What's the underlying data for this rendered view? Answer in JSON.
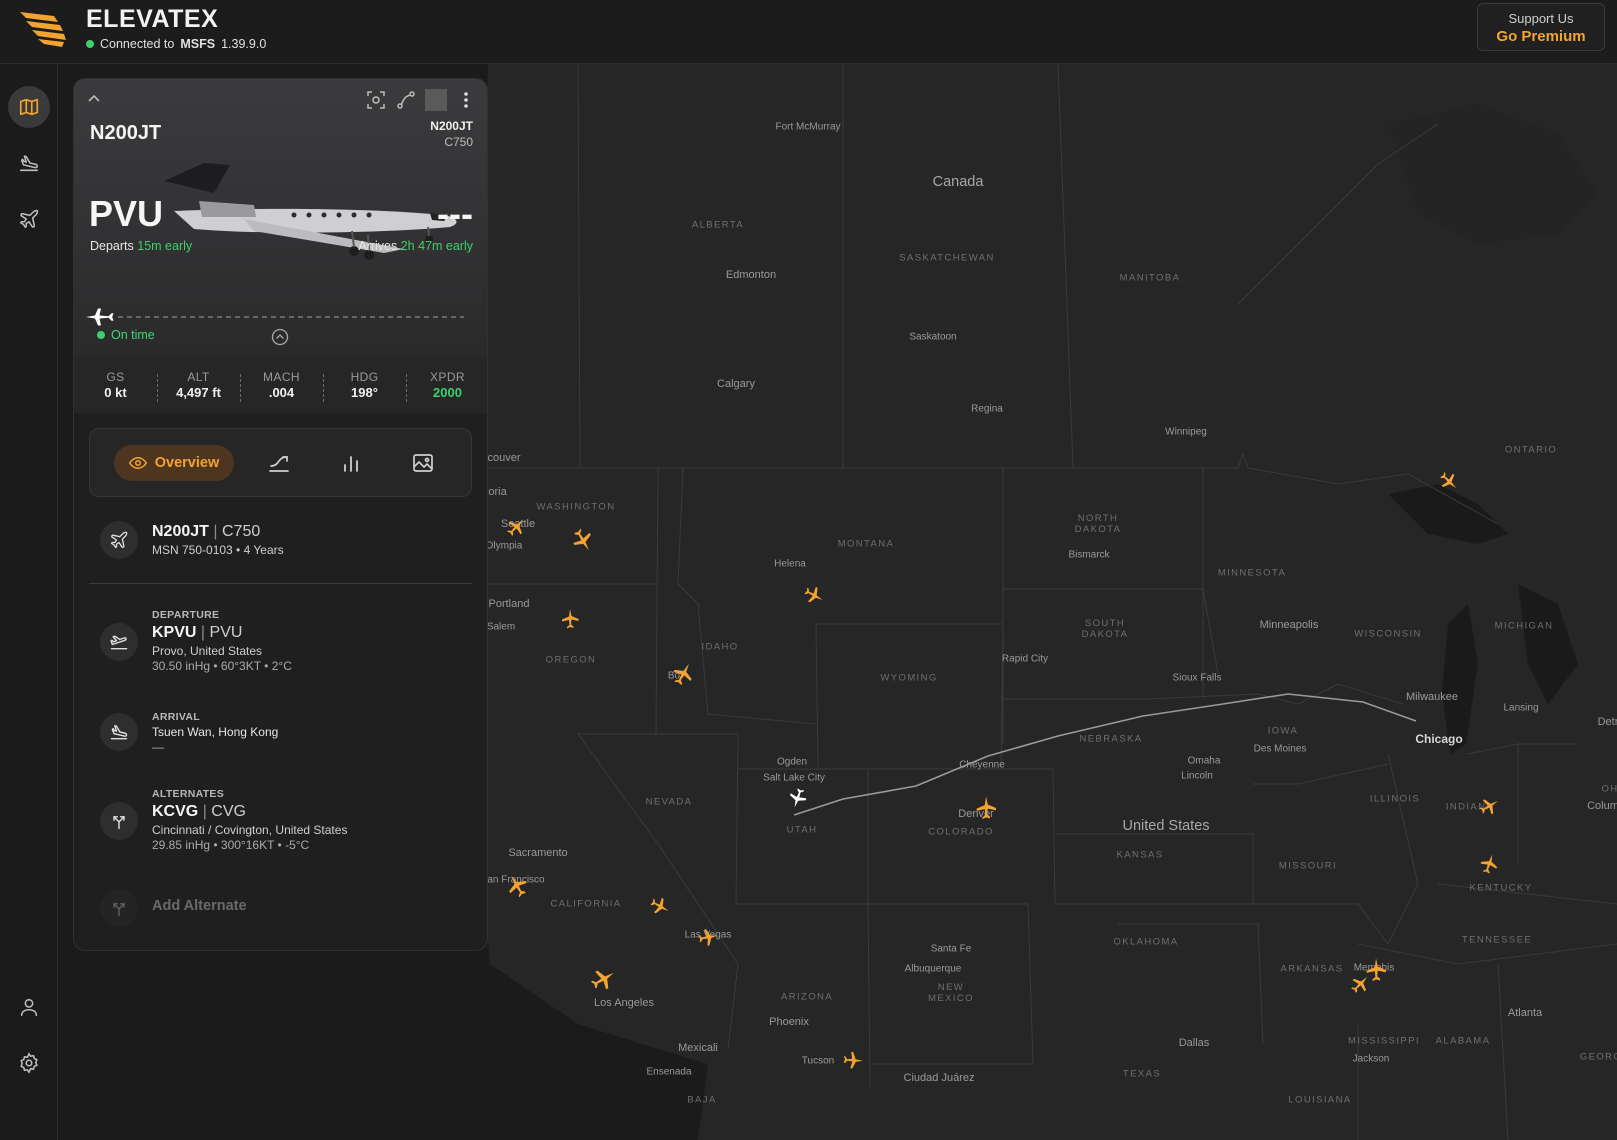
{
  "app": {
    "brand": "ELEVATEX",
    "connection_prefix": "Connected to",
    "sim_name": "MSFS",
    "sim_version": "1.39.9.0",
    "support_label": "Support Us",
    "premium_label": "Go Premium",
    "accent_color": "#f3a332",
    "status_color": "#3fcf6e"
  },
  "sidebar": {
    "items": [
      {
        "name": "map-icon",
        "active": true
      },
      {
        "name": "landing-icon",
        "active": false
      },
      {
        "name": "plane-icon",
        "active": false
      },
      {
        "name": "user-icon",
        "active": false
      },
      {
        "name": "settings-icon",
        "active": false
      }
    ]
  },
  "card": {
    "registration": "N200JT",
    "registration_small": "N200JT",
    "type_small": "C750",
    "departure_code": "PVU",
    "arrival_code": "---",
    "departs_label": "Departs",
    "departs_delta": "15m early",
    "arrives_label": "Arrives",
    "arrives_delta": "2h 47m early",
    "flight_status": "On time",
    "stats": [
      {
        "key": "GS",
        "value": "0 kt"
      },
      {
        "key": "ALT",
        "value": "4,497 ft"
      },
      {
        "key": "MACH",
        "value": ".004"
      },
      {
        "key": "HDG",
        "value": "198°"
      },
      {
        "key": "XPDR",
        "value": "2000"
      }
    ],
    "tabs": {
      "overview": "Overview",
      "icons": [
        "flight-path-icon",
        "bar-chart-icon",
        "image-icon"
      ]
    },
    "aircraft": {
      "registration": "N200JT",
      "type": "C750",
      "details": "MSN 750-0103 • 4 Years"
    },
    "departure": {
      "caption": "DEPARTURE",
      "icao": "KPVU",
      "iata": "PVU",
      "location": "Provo, United States",
      "weather": "30.50 inHg • 60°3KT • 2°C"
    },
    "arrival": {
      "caption": "ARRIVAL",
      "location": "Tsuen Wan, Hong Kong",
      "weather": "—"
    },
    "alternates": {
      "caption": "ALTERNATES",
      "icao": "KCVG",
      "iata": "CVG",
      "location": "Cincinnati / Covington, United States",
      "weather": "29.85 inHg • 300°16KT • -5°C"
    },
    "add_alternate": "Add Alternate"
  },
  "map": {
    "countries": [
      "Canada",
      "United States"
    ],
    "states": [
      "ALBERTA",
      "SASKATCHEWAN",
      "MANITOBA",
      "ONTARIO",
      "WASHINGTON",
      "MONTANA",
      "NORTH DAKOTA",
      "MINNESOTA",
      "SOUTH DAKOTA",
      "WISCONSIN",
      "MICHIGAN",
      "OREGON",
      "IDAHO",
      "WYOMING",
      "IOWA",
      "NEBRASKA",
      "NEVADA",
      "UTAH",
      "COLORADO",
      "KANSAS",
      "ILLINOIS",
      "INDIANA",
      "OH",
      "KENTUCKY",
      "MISSOURI",
      "CALIFORNIA",
      "TENNESSEE",
      "OKLAHOMA",
      "ARKANSAS",
      "NEW MEXICO",
      "ARIZONA",
      "MISSISSIPPI",
      "ALABAMA",
      "GEORG",
      "TEXAS",
      "LOUISIANA",
      "BAJA"
    ],
    "cities": [
      "Fort McMurray",
      "Edmonton",
      "Saskatoon",
      "Calgary",
      "Regina",
      "Winnipeg",
      "couver",
      "toria",
      "Seattle",
      "Olympia",
      "Helena",
      "Bismarck",
      "Portland",
      "Salem",
      "Minneapolis",
      "Rapid City",
      "Sioux Falls",
      "Milwaukee",
      "Lansing",
      "Detr",
      "Chicago",
      "Des Moines",
      "Omaha",
      "Lincoln",
      "Ogden",
      "Salt Lake City",
      "Cheyenne",
      "Denver",
      "Colum",
      "Sacramento",
      "an Francisco",
      "Las Vegas",
      "Santa Fe",
      "Albuquerque",
      "Los Angeles",
      "Phoenix",
      "Mexicali",
      "Ensenada",
      "Tucson",
      "Ciudad Juárez",
      "Dallas",
      "Jackson",
      "Memphis",
      "Atlanta",
      "Bo"
    ]
  }
}
